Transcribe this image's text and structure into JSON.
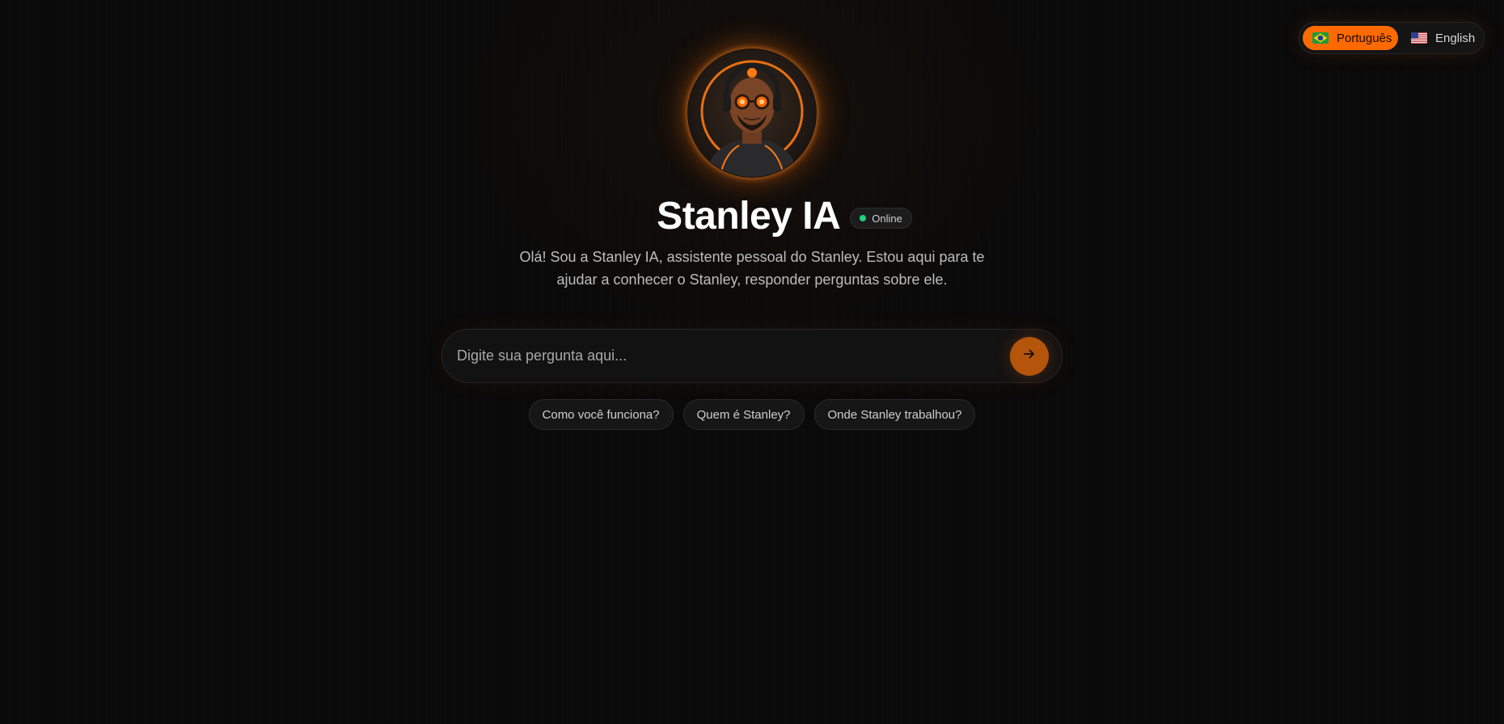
{
  "lang_switch": {
    "active": {
      "label": "Português",
      "flag": "brazil-flag"
    },
    "inactive": {
      "label": "English",
      "flag": "usa-flag"
    }
  },
  "header": {
    "title": "Stanley IA",
    "status": "Online"
  },
  "intro": {
    "text": "Olá! Sou a Stanley IA, assistente pessoal do Stanley. Estou aqui para te ajudar a conhecer o Stanley, responder perguntas sobre ele."
  },
  "search": {
    "placeholder": "Digite sua pergunta aqui...",
    "value": ""
  },
  "send": {
    "icon": "arrow-right-icon"
  },
  "suggestions": [
    "Como você funciona?",
    "Quem é Stanley?",
    "Onde Stanley trabalhou?"
  ],
  "colors": {
    "accent": "#ff6a00",
    "send_button": "#b5540b",
    "status": "#1fd17a",
    "background": "#0a0a0a"
  }
}
